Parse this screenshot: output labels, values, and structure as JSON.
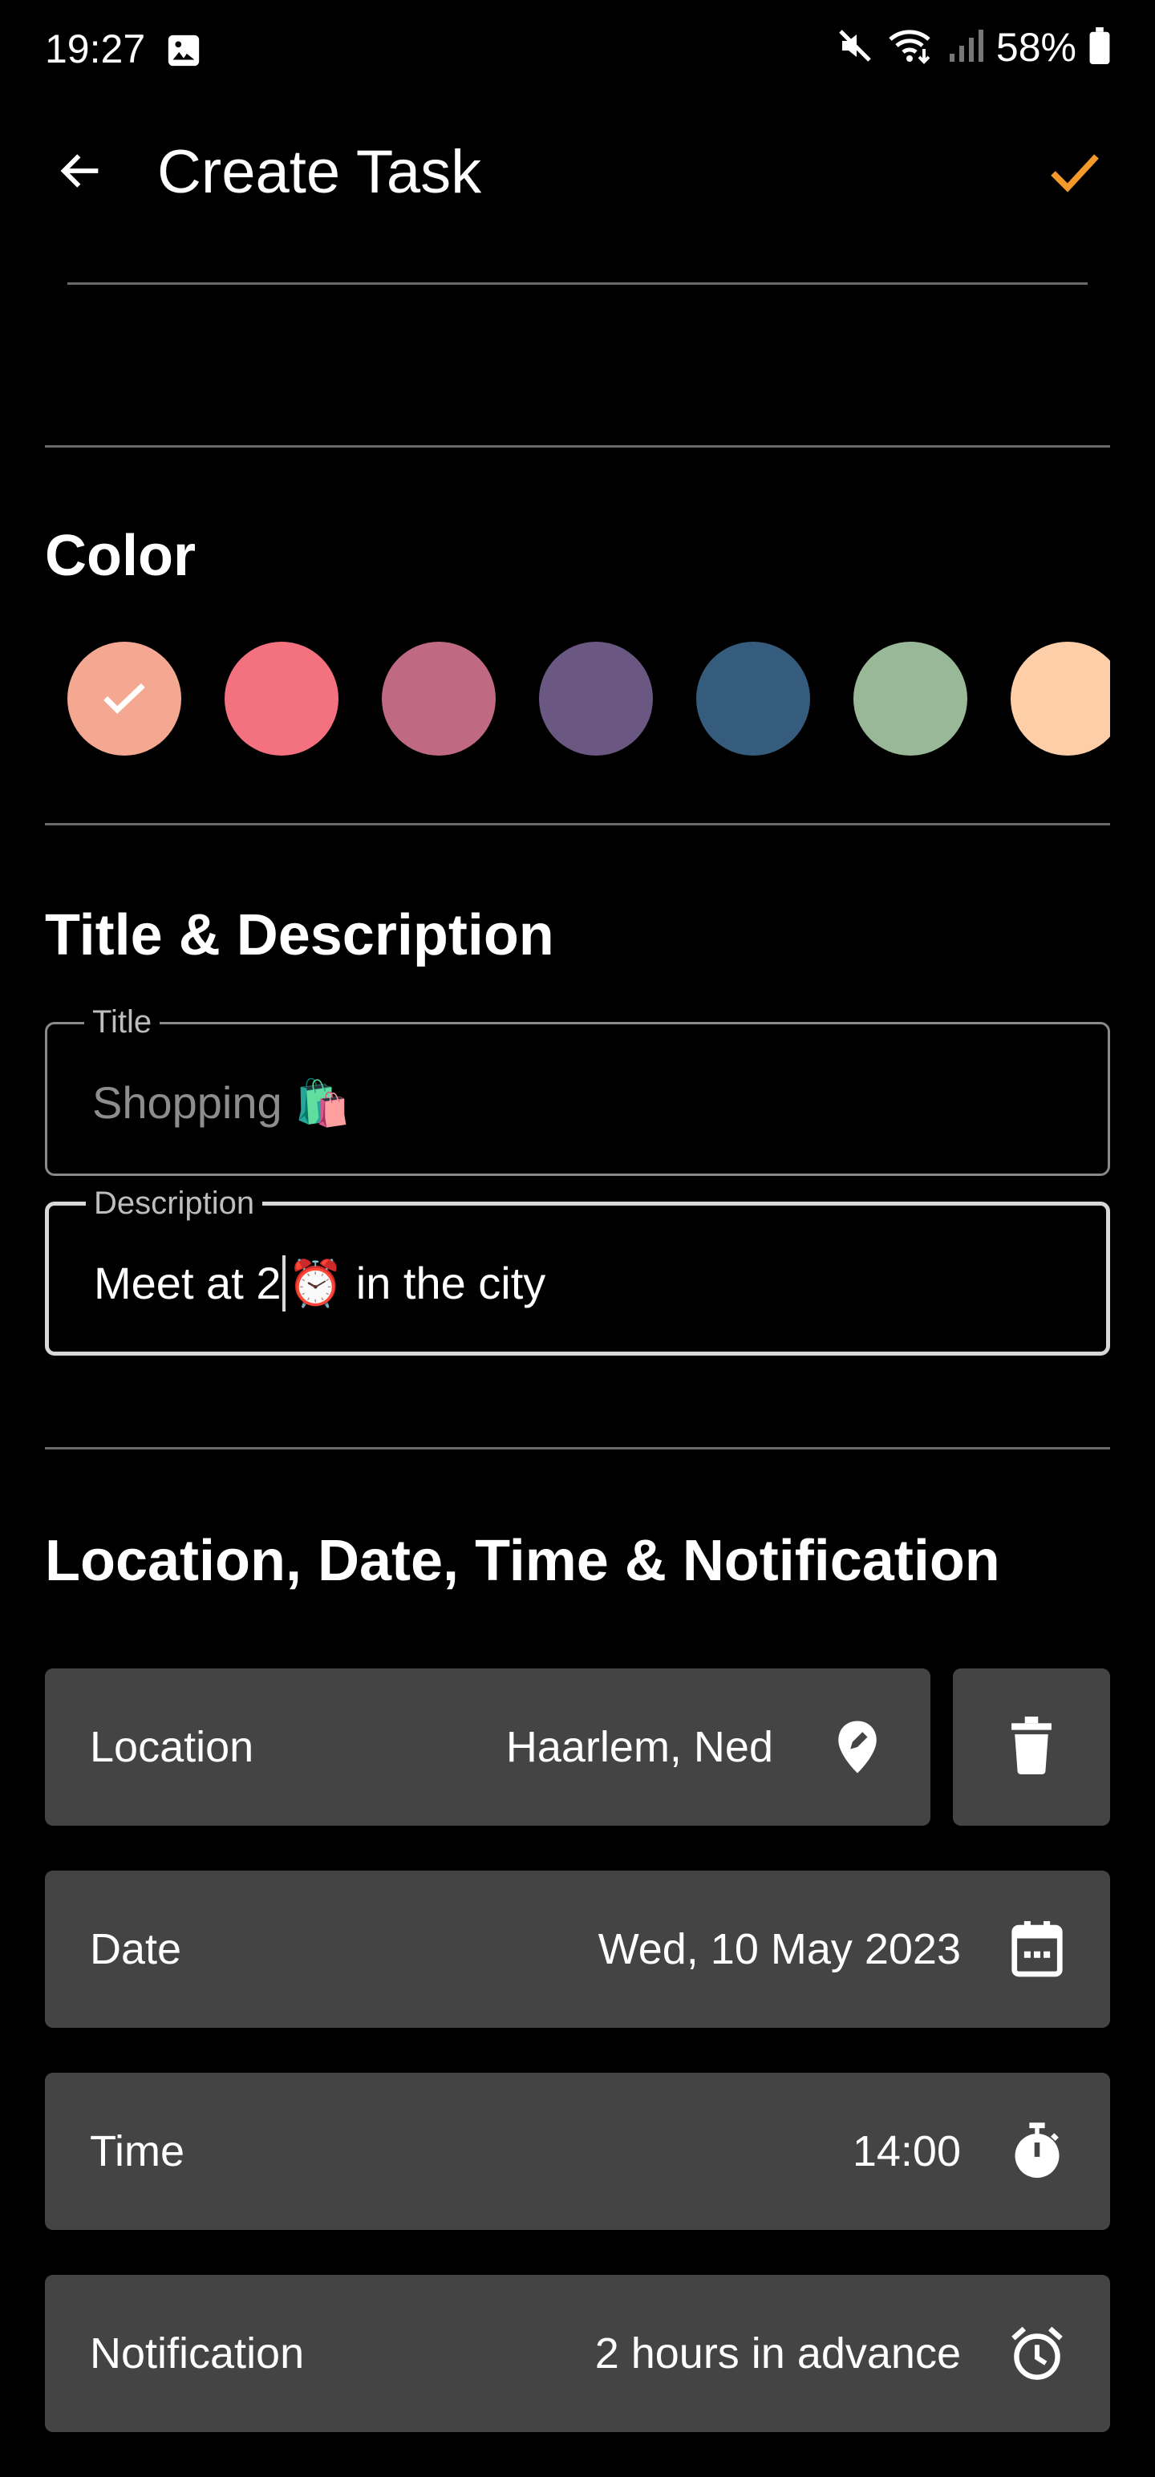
{
  "status_bar": {
    "time": "19:27",
    "battery": "58%"
  },
  "app_bar": {
    "title": "Create Task",
    "back_icon": "arrow-left-icon",
    "confirm_icon": "check-icon",
    "accent_color": "#f39a2b"
  },
  "color_section": {
    "title": "Color",
    "swatches": [
      {
        "color": "#f5a891",
        "selected": true
      },
      {
        "color": "#f4717f"
      },
      {
        "color": "#bf6a82"
      },
      {
        "color": "#6a5883"
      },
      {
        "color": "#355c7d"
      },
      {
        "color": "#99b898"
      },
      {
        "color": "#fecea8"
      }
    ]
  },
  "title_section": {
    "title": "Title & Description",
    "title_field": {
      "label": "Title",
      "placeholder": "Shopping 🛍️"
    },
    "description_field": {
      "label": "Description",
      "value_before": "Meet at 2",
      "value_after": "⏰ in the city"
    }
  },
  "details_section": {
    "title": "Location, Date, Time & Notification",
    "location": {
      "label": "Location",
      "value": "Haarlem, Ned",
      "icon": "location-pin-icon"
    },
    "delete_icon": "trash-icon",
    "date": {
      "label": "Date",
      "value": "Wed, 10 May 2023",
      "icon": "calendar-icon"
    },
    "time": {
      "label": "Time",
      "value": "14:00",
      "icon": "stopwatch-icon"
    },
    "notification": {
      "label": "Notification",
      "value": "2 hours in advance",
      "icon": "alarm-clock-icon"
    }
  }
}
